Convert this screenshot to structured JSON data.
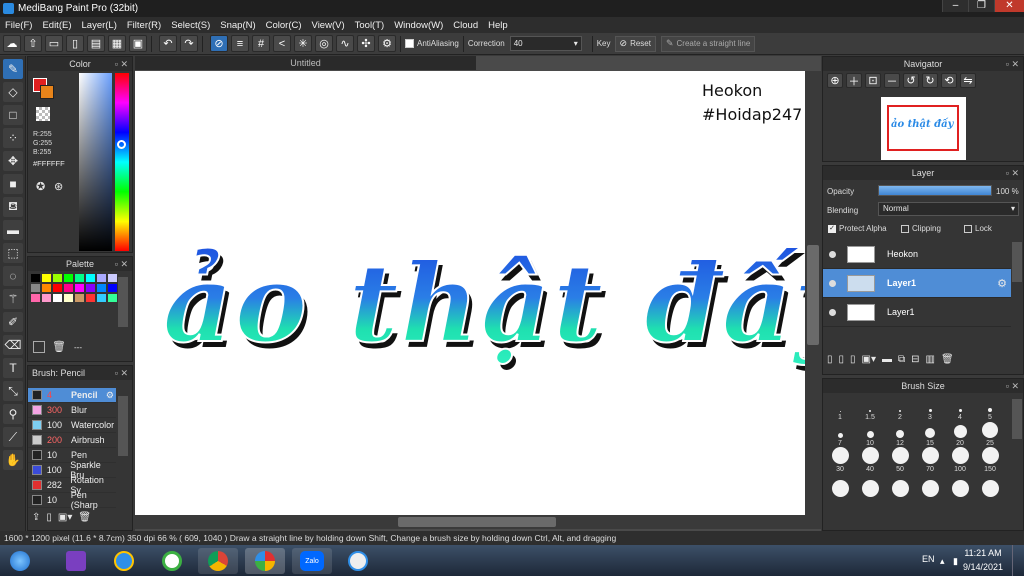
{
  "app": {
    "title": "MediBang Paint Pro (32bit)",
    "win_min": "–",
    "win_max": "❐",
    "win_close": "✕"
  },
  "menu": [
    "File(F)",
    "Edit(E)",
    "Layer(L)",
    "Filter(R)",
    "Select(S)",
    "Snap(N)",
    "Color(C)",
    "View(V)",
    "Tool(T)",
    "Window(W)",
    "Cloud",
    "Help"
  ],
  "toolbar": {
    "antialiasing": "AntiAliasing",
    "correction_label": "Correction",
    "correction_value": "40",
    "key_label": "Key",
    "reset_label": "Reset",
    "straight_line_label": "Create a straight line"
  },
  "color_panel": {
    "title": "Color",
    "r": "R:255",
    "g": "G:255",
    "b": "B:255",
    "hex": "#FFFFFF"
  },
  "palette_panel": {
    "title": "Palette",
    "footer": "---"
  },
  "brush_panel": {
    "title": "Brush: Pencil",
    "items": [
      {
        "size": "4",
        "name": "Pencil",
        "color": "#222222"
      },
      {
        "size": "300",
        "name": "Blur",
        "color": "#f4a4e4"
      },
      {
        "size": "100",
        "name": "Watercolor",
        "color": "#7ecff2"
      },
      {
        "size": "200",
        "name": "Airbrush",
        "color": "#cccccc"
      },
      {
        "size": "10",
        "name": "Pen",
        "color": "#222222"
      },
      {
        "size": "100",
        "name": "Sparkle Bru",
        "color": "#3b4cd9"
      },
      {
        "size": "282",
        "name": "Rotation Sy",
        "color": "#e03030"
      },
      {
        "size": "10",
        "name": "Pen (Sharp",
        "color": "#222222"
      }
    ]
  },
  "canvas": {
    "tab": "Untitled",
    "author": "Heokon",
    "tag": "#Hoidap247",
    "art_text": "ảo thật đấy"
  },
  "navigator": {
    "title": "Navigator",
    "preview_text": "ảo thật đấy"
  },
  "layer_panel": {
    "title": "Layer",
    "opacity_label": "Opacity",
    "opacity_value": "100 %",
    "opacity_fraction": 1.0,
    "blending_label": "Blending",
    "blending_value": "Normal",
    "protect_alpha": "Protect Alpha",
    "clipping": "Clipping",
    "lock": "Lock",
    "layers": [
      {
        "name": "Heokon"
      },
      {
        "name": "Layer1"
      },
      {
        "name": "Layer1"
      }
    ]
  },
  "brush_size_panel": {
    "title": "Brush Size",
    "sizes": [
      "1",
      "1.5",
      "2",
      "3",
      "4",
      "5",
      "7",
      "10",
      "12",
      "15",
      "20",
      "25",
      "30",
      "40",
      "50",
      "70",
      "100",
      "150"
    ]
  },
  "status": {
    "text": "1600 * 1200 pixel   (11.6 * 8.7cm)   350 dpi   66 %   ( 609, 1040 )   Draw a straight line by holding down Shift, Change a brush size by holding down Ctrl, Alt, and dragging"
  },
  "taskbar": {
    "lang": "EN",
    "time": "11:21 AM",
    "date": "9/14/2021",
    "zalo": "Zalo"
  }
}
